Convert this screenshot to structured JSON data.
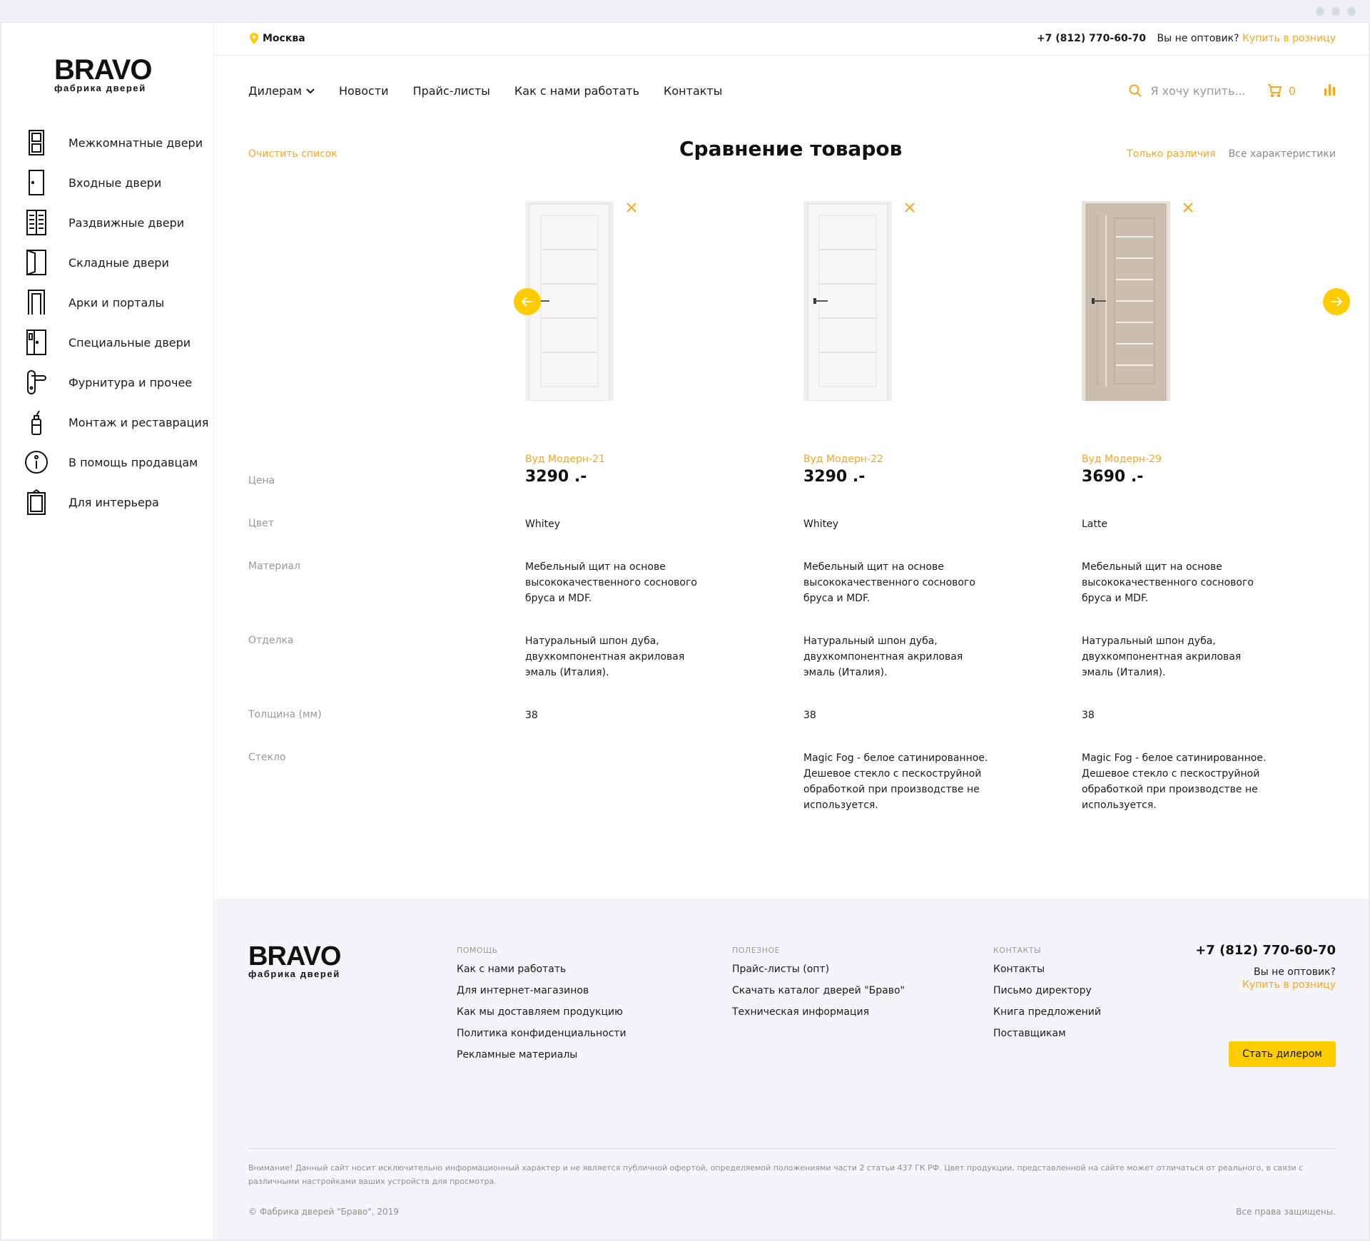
{
  "brand": {
    "name": "BRAVO",
    "tagline": "фабрика дверей"
  },
  "sidebar": {
    "items": [
      {
        "label": "Межкомнатные двери",
        "icon": "interior-door-icon"
      },
      {
        "label": "Входные двери",
        "icon": "entrance-door-icon"
      },
      {
        "label": "Раздвижные двери",
        "icon": "sliding-door-icon"
      },
      {
        "label": "Складные двери",
        "icon": "folding-door-icon"
      },
      {
        "label": "Арки и порталы",
        "icon": "arch-icon"
      },
      {
        "label": "Специальные двери",
        "icon": "special-door-icon"
      },
      {
        "label": "Фурнитура и прочее",
        "icon": "door-handle-icon"
      },
      {
        "label": "Монтаж и реставрация",
        "icon": "spray-can-icon"
      },
      {
        "label": "В помощь продавцам",
        "icon": "info-icon"
      },
      {
        "label": "Для интерьера",
        "icon": "frame-icon"
      }
    ]
  },
  "topbar": {
    "city": "Москва",
    "phone": "+7 (812) 770-60-70",
    "not_wholesaler": "Вы не оптовик?",
    "retail_link": "Купить в розницу"
  },
  "nav": {
    "items": [
      "Дилерам",
      "Новости",
      "Прайс-листы",
      "Как с нами работать",
      "Контакты"
    ],
    "search_placeholder": "Я хочу купить...",
    "cart_count": "0"
  },
  "compare": {
    "title": "Сравнение товаров",
    "clear": "Очистить список",
    "only_diff": "Только различия",
    "all_specs": "Все характеристики",
    "labels": {
      "price": "Цена",
      "color": "Цвет",
      "material": "Материал",
      "finish": "Отделка",
      "thickness": "Толщина (мм)",
      "glass": "Стекло"
    },
    "products": [
      {
        "name": "Вуд Модерн-21",
        "price": "3290 .-",
        "color": "Whitey",
        "material": "Мебельный щит на основе высококачественного соснового бруса и MDF.",
        "finish": "Натуральный шпон дуба, двухкомпонентная акриловая эмаль (Италия).",
        "thickness": "38",
        "glass": "",
        "door_color": "#f7f7f5"
      },
      {
        "name": "Вуд Модерн-22",
        "price": "3290 .-",
        "color": "Whitey",
        "material": "Мебельный щит на основе высококачественного соснового бруса и MDF.",
        "finish": "Натуральный шпон дуба, двухкомпонентная акриловая эмаль (Италия).",
        "thickness": "38",
        "glass": "Magic Fog - белое сатинированное. Дешевое стекло с пескоструйной обработкой при производстве не используется.",
        "door_color": "#f7f7f5"
      },
      {
        "name": "Вуд Модерн-29",
        "price": "3690 .-",
        "color": "Latte",
        "material": "Мебельный щит на основе высококачественного соснового бруса и MDF.",
        "finish": "Натуральный шпон дуба, двухкомпонентная акриловая эмаль (Италия).",
        "thickness": "38",
        "glass": "Magic Fog - белое сатинированное. Дешевое стекло с пескоструйной обработкой при производстве не используется.",
        "door_color": "#cdbfaf"
      }
    ]
  },
  "footer": {
    "help": {
      "head": "ПОМОЩЬ",
      "links": [
        "Как с нами работать",
        "Для интернет-магазинов",
        "Как мы доставляем продукцию",
        "Политика конфиденциальности",
        "Рекламные материалы"
      ]
    },
    "useful": {
      "head": "ПОЛЕЗНОЕ",
      "links": [
        "Прайс-листы (опт)",
        "Скачать каталог дверей \"Браво\"",
        "Техническая информация"
      ]
    },
    "contacts": {
      "head": "КОНТАКТЫ",
      "links": [
        "Контакты",
        "Письмо директору",
        "Книга предложений",
        "Поставщикам"
      ]
    },
    "phone": "+7 (812) 770-60-70",
    "not_wholesaler": "Вы не оптовик?",
    "retail_link": "Купить в розницу",
    "dealer_button": "Стать дилером",
    "disclaimer": "Внимание! Данный сайт носит исключительно информационный характер и не является публичной офертой, определяемой положениями части 2 статьи 437 ГК РФ. Цвет продукции, представленной на сайте может отличаться от реального, в связи с различными настройками ваших устройств для просмотра.",
    "copyright": "© Фабрика дверей \"Браво\", 2019",
    "rights": "Все права защищены."
  },
  "colors": {
    "accent": "#f5a623",
    "yellow": "#ffcc00"
  }
}
